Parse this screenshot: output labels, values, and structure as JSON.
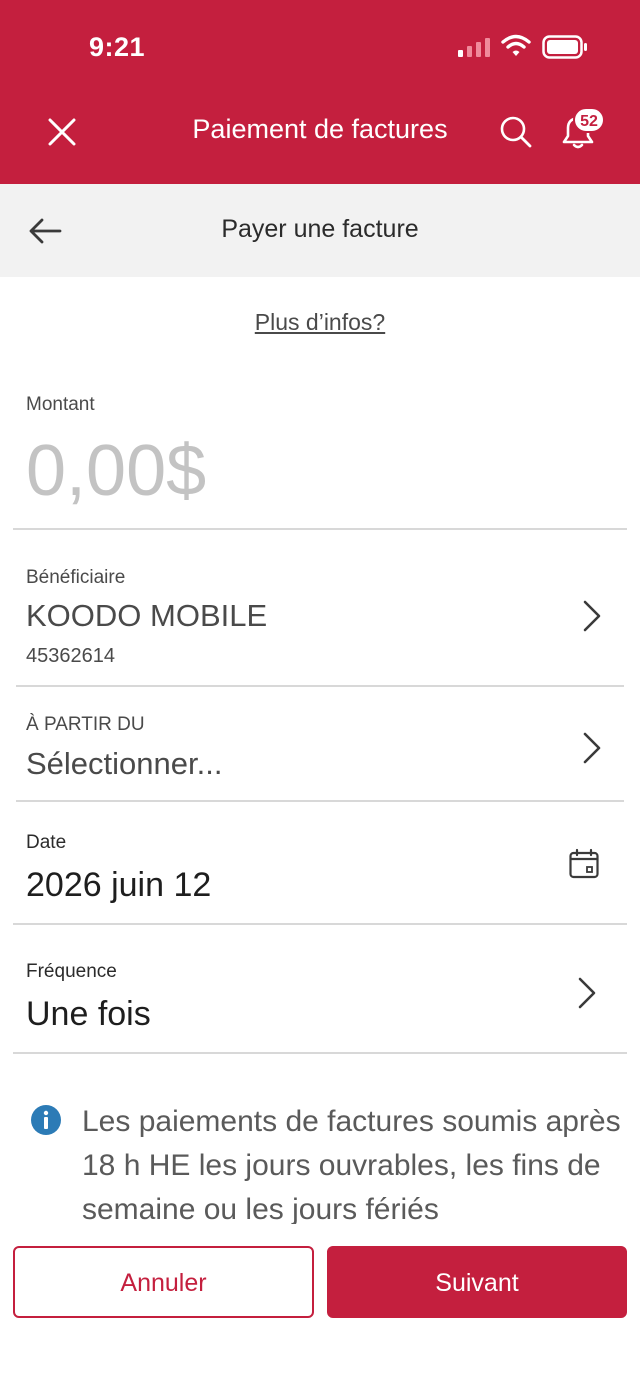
{
  "status_bar": {
    "time": "9:21"
  },
  "header": {
    "title": "Paiement de factures",
    "notification_count": "52",
    "accent_color": "#c41f3e"
  },
  "subheader": {
    "title": "Payer une facture"
  },
  "help_link": "Plus d’infos?",
  "form": {
    "amount": {
      "label": "Montant",
      "value": "0,00$"
    },
    "payee": {
      "label": "Bénéficiaire",
      "name": "KOODO MOBILE",
      "account": "45362614"
    },
    "from_account": {
      "label": "À PARTIR DU",
      "value": "Sélectionner..."
    },
    "date": {
      "label": "Date",
      "value": "2026 juin 12"
    },
    "frequency": {
      "label": "Fréquence",
      "value": "Une fois"
    }
  },
  "info_message": "Les paiements de factures soumis après 18 h HE les jours ouvrables, les fins de semaine ou les jours fériés",
  "actions": {
    "cancel": "Annuler",
    "next": "Suivant"
  },
  "icons": [
    "signal-icon",
    "wifi-icon",
    "battery-icon",
    "close-icon",
    "search-icon",
    "bell-icon",
    "back-arrow-icon",
    "chevron-right-icon",
    "calendar-icon",
    "info-icon"
  ]
}
